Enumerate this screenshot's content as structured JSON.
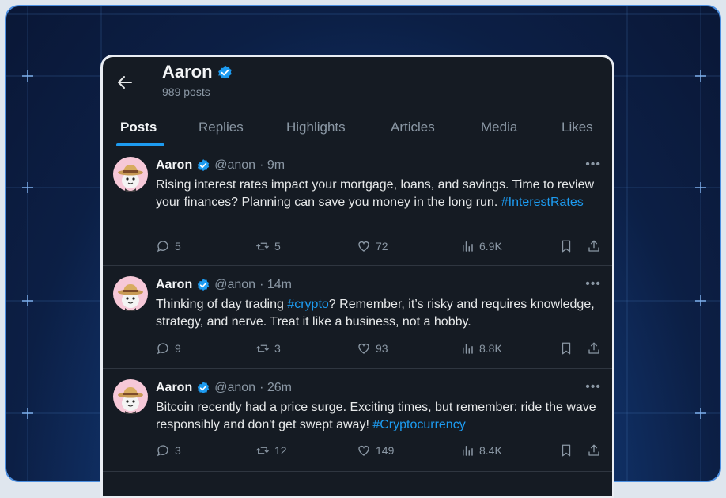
{
  "profile": {
    "name": "Aaron",
    "post_count": "989 posts"
  },
  "tabs": [
    "Posts",
    "Replies",
    "Highlights",
    "Articles",
    "Media",
    "Likes"
  ],
  "colors": {
    "accent": "#1d9bf0",
    "background": "#151b23",
    "muted": "#8b98a5"
  },
  "posts": [
    {
      "name": "Aaron",
      "handle": "@anon",
      "time": "· 9m",
      "text_before": "Rising interest rates impact your mortgage, loans, and savings. Time to review your finances? Planning can save you money in the long run. ",
      "hashtag": "#InterestRates",
      "text_after": "",
      "replies": "5",
      "reposts": "5",
      "likes": "72",
      "views": "6.9K"
    },
    {
      "name": "Aaron",
      "handle": "@anon",
      "time": "· 14m",
      "text_before": "Thinking of day trading ",
      "hashtag": "#crypto",
      "text_after": "? Remember, it’s risky and requires knowledge, strategy, and nerve. Treat it like a business, not a hobby.",
      "replies": "9",
      "reposts": "3",
      "likes": "93",
      "views": "8.8K"
    },
    {
      "name": "Aaron",
      "handle": "@anon",
      "time": "· 26m",
      "text_before": "Bitcoin recently had a price surge. Exciting times, but remember: ride the wave responsibly and don't get swept away! ",
      "hashtag": "#Cryptocurrency",
      "text_after": "",
      "replies": "3",
      "reposts": "12",
      "likes": "149",
      "views": "8.4K"
    }
  ],
  "icons": {
    "back": "arrow-left-icon",
    "verified": "verified-badge-icon",
    "more": "more-icon",
    "reply": "reply-icon",
    "repost": "repost-icon",
    "like": "heart-icon",
    "views": "views-icon",
    "bookmark": "bookmark-icon",
    "share": "share-icon"
  }
}
